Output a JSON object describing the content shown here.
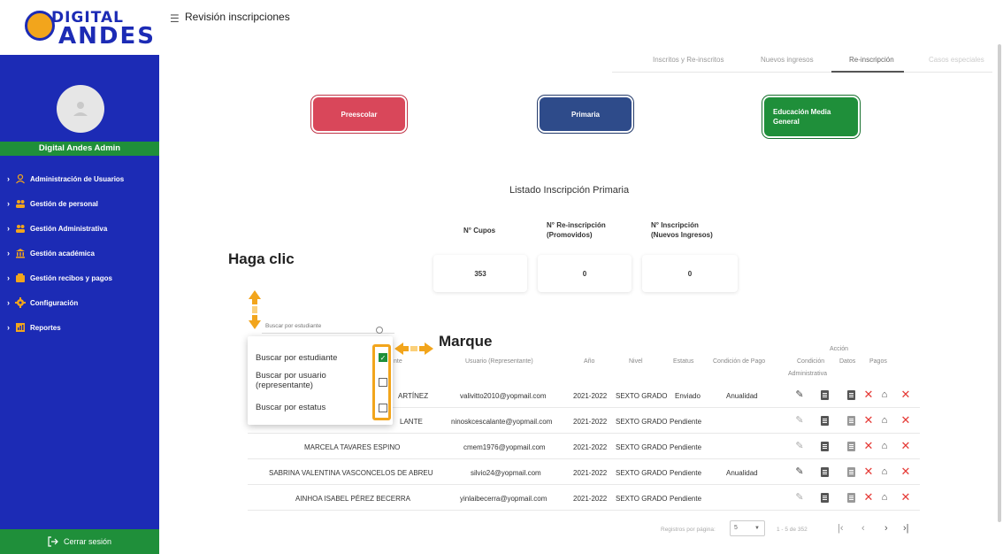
{
  "app": {
    "logo_top": "DIGITAL",
    "logo_bottom": "ANDES",
    "user_name": "Digital Andes Admin",
    "page_title": "Revisión inscripciones",
    "logout_label": "Cerrar sesión"
  },
  "sidebar": {
    "items": [
      {
        "label": "Administración de Usuarios",
        "icon": "user-icon"
      },
      {
        "label": "Gestión de personal",
        "icon": "people-icon"
      },
      {
        "label": "Gestión Administrativa",
        "icon": "people-icon"
      },
      {
        "label": "Gestión académica",
        "icon": "bank-icon"
      },
      {
        "label": "Gestión recibos y pagos",
        "icon": "wallet-icon"
      },
      {
        "label": "Configuración",
        "icon": "gear-icon"
      },
      {
        "label": "Reportes",
        "icon": "report-icon"
      }
    ]
  },
  "tabs": [
    "Inscritos y Re-inscritos",
    "Nuevos ingresos",
    "Re-inscripción",
    "Casos especiales"
  ],
  "levels": {
    "preescolar": "Preescolar",
    "primaria": "Primaria",
    "media_1": "Educación Media",
    "media_2": "General"
  },
  "list_title": "Listado Inscripción Primaria",
  "stats": {
    "cupos_label": "N° Cupos",
    "reins_label_1": "N° Re-inscripción",
    "reins_label_2": "(Promovidos)",
    "ins_label_1": "N° Inscripción",
    "ins_label_2": "(Nuevos Ingresos)",
    "cupos_value": "353",
    "reins_value": "0",
    "ins_value": "0"
  },
  "annotations": {
    "haga_clic": "Haga clic",
    "marque": "Marque"
  },
  "search": {
    "placeholder": "Buscar por estudiante"
  },
  "dropdown": {
    "opt1": "Buscar por estudiante",
    "opt2_1": "Buscar por usuario",
    "opt2_2": "(representante)",
    "opt3": "Buscar por estatus",
    "checked_mark": "✓"
  },
  "table": {
    "headers": {
      "estudiante_partial": "nte",
      "usuario": "Usuario (Representante)",
      "ano": "Año",
      "nivel": "Nivel",
      "estatus": "Estatus",
      "condicion_pago": "Condición de Pago",
      "accion": "Acción",
      "condicion_1": "Condición",
      "condicion_2": "Administrativa",
      "datos": "Datos",
      "pagos": "Pagos"
    },
    "rows": [
      {
        "estudiante": "ARTÍNEZ",
        "usuario": "valivitto2010@yopmail.com",
        "ano": "2021-2022",
        "nivel": "SEXTO GRADO",
        "estatus": "Enviado",
        "pago": "Anualidad"
      },
      {
        "estudiante": "LANTE",
        "usuario": "ninoskcescalante@yopmail.com",
        "ano": "2021-2022",
        "nivel": "SEXTO GRADO",
        "estatus": "Pendiente",
        "pago": ""
      },
      {
        "estudiante": "MARCELA TAVARES ESPINO",
        "usuario": "cmem1976@yopmail.com",
        "ano": "2021-2022",
        "nivel": "SEXTO GRADO",
        "estatus": "Pendiente",
        "pago": ""
      },
      {
        "estudiante": "SABRINA VALENTINA VASCONCELOS DE ABREU",
        "usuario": "silvio24@yopmail.com",
        "ano": "2021-2022",
        "nivel": "SEXTO GRADO",
        "estatus": "Pendiente",
        "pago": "Anualidad"
      },
      {
        "estudiante": "AINHOA ISABEL PÉREZ BECERRA",
        "usuario": "yinlaibecerra@yopmail.com",
        "ano": "2021-2022",
        "nivel": "SEXTO GRADO",
        "estatus": "Pendiente",
        "pago": ""
      }
    ]
  },
  "pagination": {
    "label": "Registros por página:",
    "per_page": "5",
    "range": "1 - 5 de 352"
  },
  "colors": {
    "sidebar": "#1c2bb5",
    "green": "#1f8f3a",
    "preescolar": "#d9475a",
    "primaria": "#2e4b8a",
    "highlight": "#f2a51c",
    "delete": "#e53935"
  }
}
